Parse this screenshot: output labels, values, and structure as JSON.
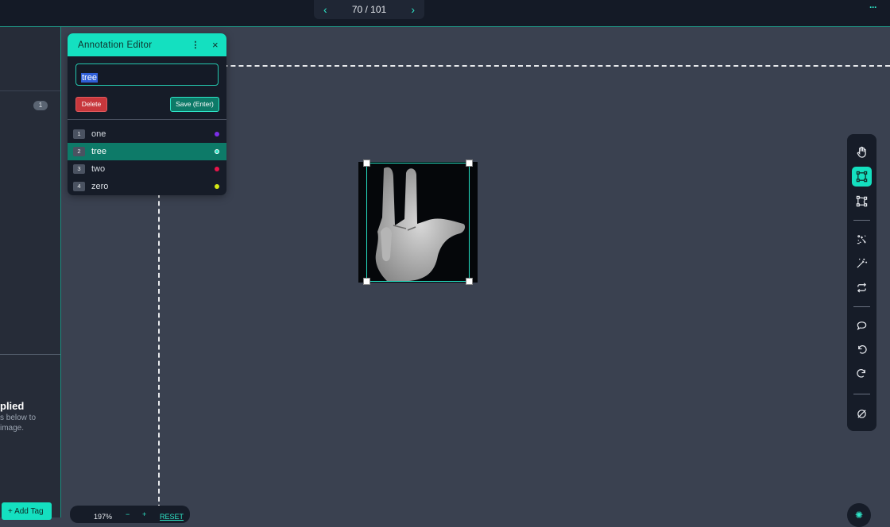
{
  "pager": {
    "prev_icon": "chevron-left-icon",
    "count": "70 / 101",
    "next_icon": "chevron-right-icon"
  },
  "topbar": {
    "menu": "···"
  },
  "sidebar": {
    "badge": "1",
    "applied": "plied",
    "hint_line1": "s below to",
    "hint_line2": "image.",
    "add_tag": "+ Add Tag"
  },
  "editor": {
    "title": "Annotation Editor",
    "more": "⋮",
    "close": "×",
    "input_value": "tree",
    "delete_label": "Delete",
    "save_label": "Save (Enter)",
    "labels": [
      {
        "key": "1",
        "name": "one",
        "color": "#7c2ee8",
        "active": false
      },
      {
        "key": "2",
        "name": "tree",
        "color": "#2ee6c8",
        "active": true
      },
      {
        "key": "3",
        "name": "two",
        "color": "#e8154a",
        "active": false
      },
      {
        "key": "4",
        "name": "zero",
        "color": "#d4e815",
        "active": false
      }
    ]
  },
  "toolbar": {
    "tools": [
      {
        "name": "hand-tool",
        "icon": "hand-icon",
        "active": false
      },
      {
        "name": "bbox-tool",
        "icon": "bounding-box-icon",
        "active": true
      },
      {
        "name": "polygon-tool",
        "icon": "polygon-icon",
        "active": false
      },
      {
        "name": "auto-detect-tool",
        "icon": "sparkle-scan-icon",
        "active": false
      },
      {
        "name": "magic-wand-tool",
        "icon": "magic-wand-icon",
        "active": false
      },
      {
        "name": "repeat-tool",
        "icon": "repeat-icon",
        "active": false
      },
      {
        "name": "comment-tool",
        "icon": "speech-bubble-icon",
        "active": false
      },
      {
        "name": "undo-tool",
        "icon": "undo-icon",
        "active": false
      },
      {
        "name": "redo-tool",
        "icon": "redo-icon",
        "active": false
      },
      {
        "name": "hide-tool",
        "icon": "eye-off-icon",
        "active": false
      }
    ]
  },
  "zoom": {
    "percent": "197%",
    "minus": "−",
    "plus": "+",
    "reset": "RESET"
  },
  "corner": {
    "icon": "sun-icon"
  },
  "colors": {
    "accent": "#14e0c0",
    "panel": "#161c28",
    "canvas": "#3a4150",
    "danger": "#c7373c"
  }
}
